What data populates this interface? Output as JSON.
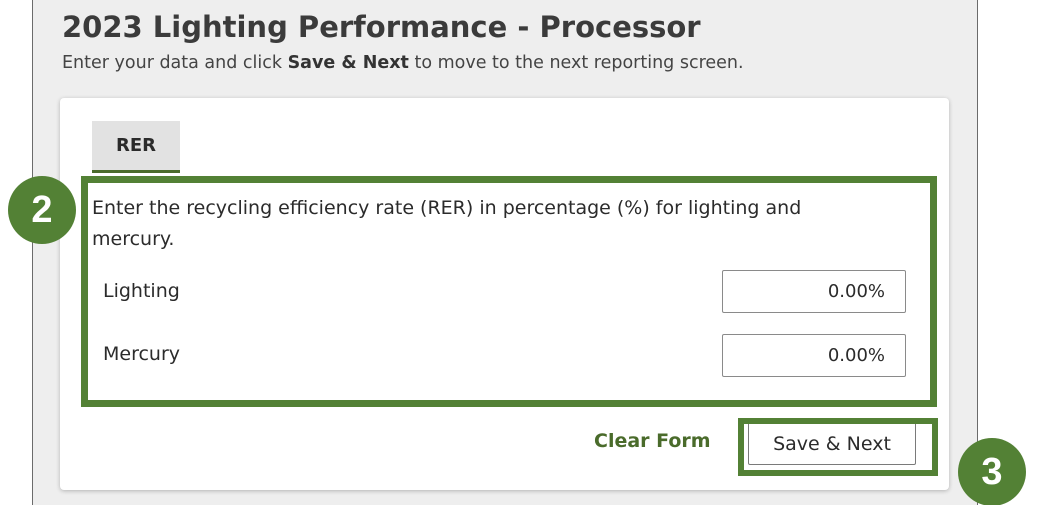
{
  "header": {
    "title": "2023 Lighting Performance - Processor",
    "subtitle_before": "Enter your data and click ",
    "subtitle_bold": "Save & Next",
    "subtitle_after": " to move to the next reporting screen."
  },
  "tabs": [
    {
      "label": "RER",
      "active": true
    }
  ],
  "form": {
    "instructions": "Enter the recycling efficiency rate (RER) in percentage (%) for lighting and mercury.",
    "fields": [
      {
        "label": "Lighting",
        "value": "0.00%"
      },
      {
        "label": "Mercury",
        "value": "0.00%"
      }
    ],
    "clear_label": "Clear Form",
    "save_label": "Save & Next"
  },
  "annotations": {
    "step_2": "2",
    "step_3": "3",
    "highlight_color": "#538135"
  }
}
